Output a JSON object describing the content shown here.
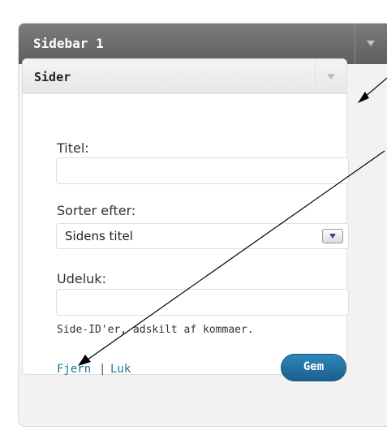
{
  "sidebar": {
    "title": "Sidebar 1",
    "toggle_icon": "triangle-down-icon"
  },
  "widget": {
    "title": "Sider",
    "toggle_icon": "triangle-down-icon",
    "fields": {
      "title_label": "Titel:",
      "title_value": "",
      "sort_label": "Sorter efter:",
      "sort_value": "Sidens titel",
      "exclude_label": "Udeluk:",
      "exclude_value": "",
      "exclude_help": "Side-ID'er, adskilt af kommaer."
    },
    "actions": {
      "remove_label": "Fjern",
      "separator": "|",
      "close_label": "Luk",
      "save_label": "Gem"
    }
  },
  "colors": {
    "link": "#21759b",
    "save_button": "#2379a8",
    "sidebar_header": "#6b6b6b"
  }
}
